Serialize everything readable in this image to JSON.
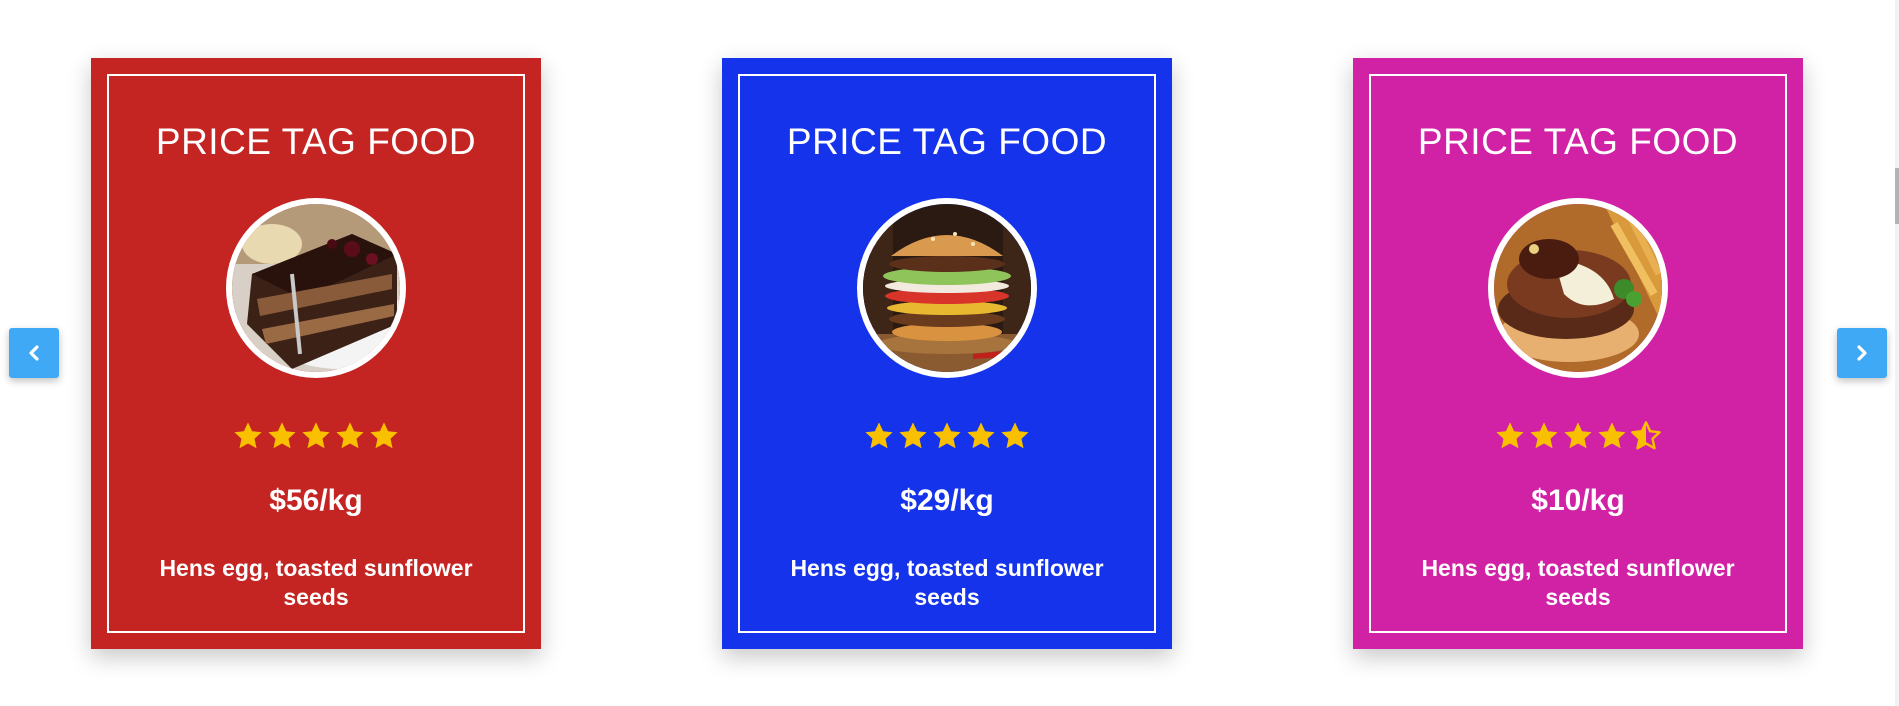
{
  "colors": {
    "card_red": "#c42422",
    "card_blue": "#1433eb",
    "card_magenta": "#d122a6",
    "star": "#f9c000",
    "nav_button": "#3fa9f5"
  },
  "carousel": {
    "prev_icon": "chevron-left-icon",
    "next_icon": "chevron-right-icon",
    "cards": [
      {
        "title": "PRICE TAG FOOD",
        "image": "chocolate-cake-slice",
        "rating": 5,
        "price": "$56/kg",
        "description": "Hens egg, toasted sunflower seeds"
      },
      {
        "title": "PRICE TAG FOOD",
        "image": "stacked-burger",
        "rating": 5,
        "price": "$29/kg",
        "description": "Hens egg, toasted sunflower seeds"
      },
      {
        "title": "PRICE TAG FOOD",
        "image": "cheese-burger-with-fries",
        "rating": 4.5,
        "price": "$10/kg",
        "description": "Hens egg, toasted sunflower seeds"
      }
    ]
  }
}
